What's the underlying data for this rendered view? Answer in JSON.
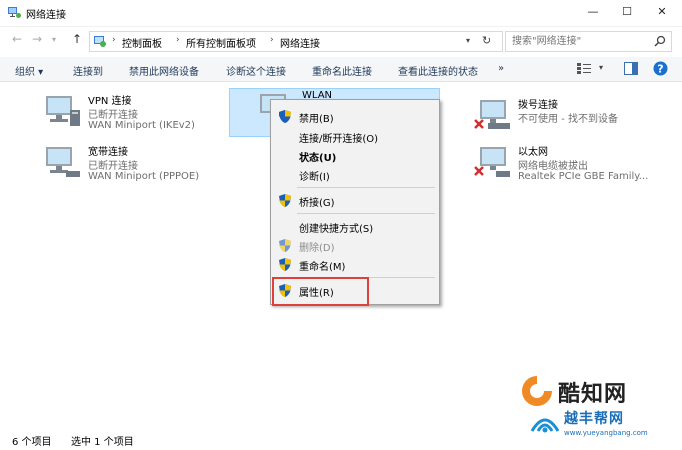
{
  "window": {
    "title": "网络连接",
    "minimize": "—",
    "maximize": "☐",
    "close": "✕"
  },
  "address": {
    "segments": [
      "控制面板",
      "所有控制面板项",
      "网络连接"
    ],
    "separator": "›",
    "search_placeholder": "搜索\"网络连接\""
  },
  "toolbar": {
    "items": [
      "组织 ▾",
      "连接到",
      "禁用此网络设备",
      "诊断这个连接",
      "重命名此连接",
      "查看此连接的状态",
      "»"
    ]
  },
  "connections": [
    {
      "name": "VPN 连接",
      "status": "已断开连接",
      "device": "WAN Miniport (IKEv2)"
    },
    {
      "name": "宽带连接",
      "status": "已断开连接",
      "device": "WAN Miniport (PPPOE)"
    },
    {
      "name": "WLAN",
      "status": "",
      "device": ""
    },
    {
      "name": "拨号连接",
      "status": "不可使用 - 找不到设备",
      "device": ""
    },
    {
      "name": "以太网",
      "status": "网络电缆被拔出",
      "device": "Realtek PCIe GBE Family..."
    }
  ],
  "context_menu": {
    "disable": "禁用(B)",
    "connect": "连接/断开连接(O)",
    "status": "状态(U)",
    "diagnose": "诊断(I)",
    "bridge": "桥接(G)",
    "shortcut": "创建快捷方式(S)",
    "delete": "删除(D)",
    "rename": "重命名(M)",
    "properties": "属性(R)"
  },
  "statusbar": {
    "count": "6 个项目",
    "selected": "选中 1 个项目"
  },
  "watermark": {
    "brand1": "酷知网",
    "brand2": "越丰帮网",
    "url": "www.yueyangbang.com"
  },
  "colors": {
    "selection": "#cce8ff",
    "highlight_border": "#e0403a",
    "help_icon": "#1a6fd0"
  }
}
